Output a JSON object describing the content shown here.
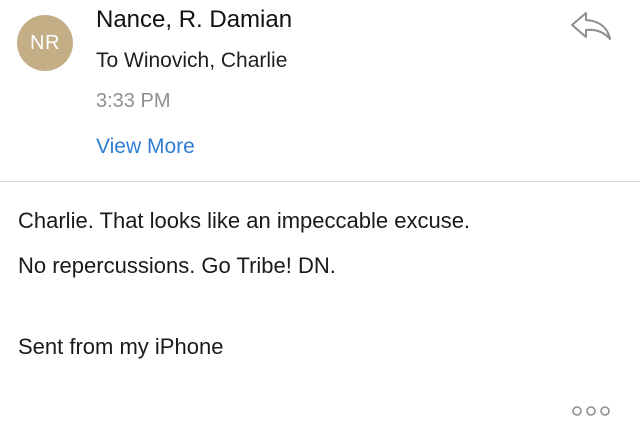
{
  "message": {
    "avatar_initials": "NR",
    "sender": "Nance, R. Damian",
    "recipient": "To Winovich, Charlie",
    "time": "3:33 PM",
    "view_more": "View More",
    "body_line_1": "Charlie. That looks like an impeccable excuse.",
    "body_line_2": "No repercussions. Go Tribe! DN.",
    "signature": "Sent from my iPhone"
  },
  "icons": {
    "reply": "reply-icon",
    "more": "more-options-icon"
  },
  "colors": {
    "avatar": "#c3ae86",
    "link": "#2f7dd4",
    "secondary_text": "#8e8e93",
    "divider": "#d9d9dc"
  }
}
